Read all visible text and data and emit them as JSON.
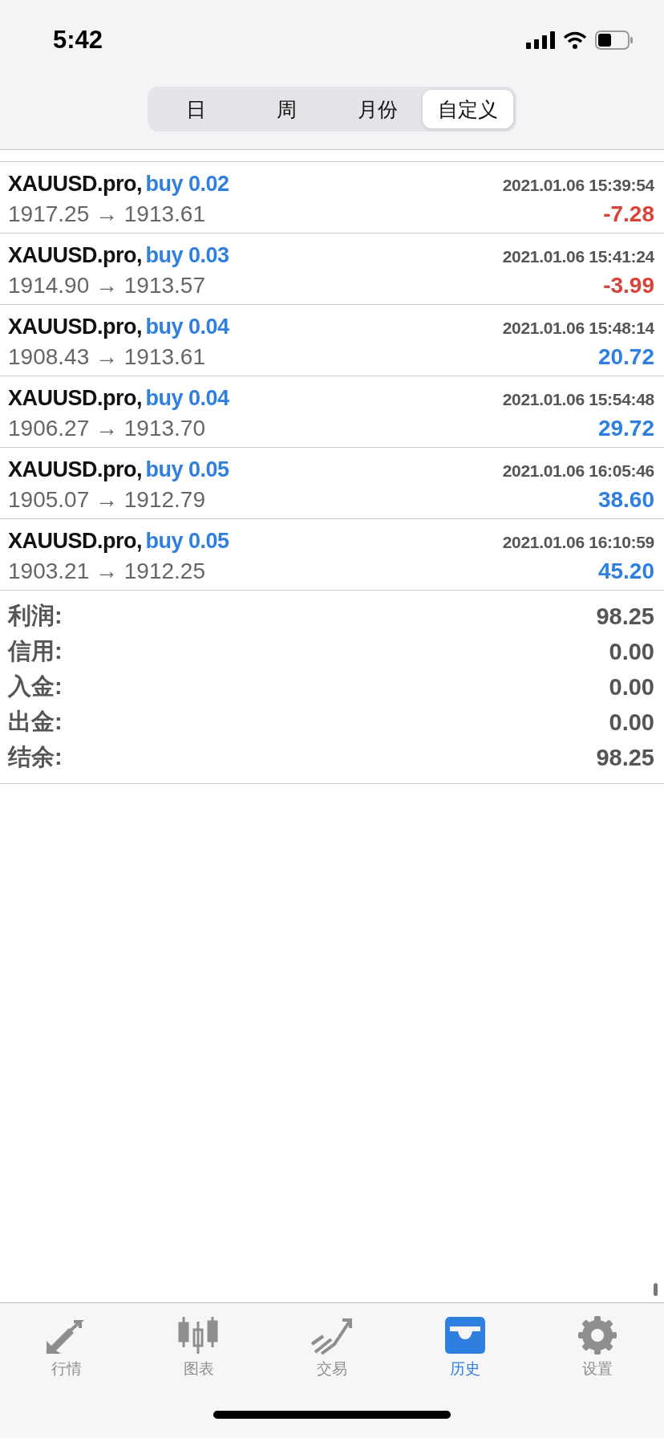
{
  "status_bar": {
    "time": "5:42"
  },
  "period_tabs": [
    {
      "label": "日",
      "selected": false
    },
    {
      "label": "周",
      "selected": false
    },
    {
      "label": "月份",
      "selected": false
    },
    {
      "label": "自定义",
      "selected": true
    }
  ],
  "deals": [
    {
      "symbol": "XAUUSD.pro,",
      "side": "buy 0.02",
      "time": "2021.01.06 15:39:54",
      "prices": "1917.25 → 1913.61",
      "profit": "-7.28",
      "color": "#d8433a"
    },
    {
      "symbol": "XAUUSD.pro,",
      "side": "buy 0.03",
      "time": "2021.01.06 15:41:24",
      "prices": "1914.90 → 1913.57",
      "profit": "-3.99",
      "color": "#d8433a"
    },
    {
      "symbol": "XAUUSD.pro,",
      "side": "buy 0.04",
      "time": "2021.01.06 15:48:14",
      "prices": "1908.43 → 1913.61",
      "profit": "20.72",
      "color": "#2f7fe0"
    },
    {
      "symbol": "XAUUSD.pro,",
      "side": "buy 0.04",
      "time": "2021.01.06 15:54:48",
      "prices": "1906.27 → 1913.70",
      "profit": "29.72",
      "color": "#2f7fe0"
    },
    {
      "symbol": "XAUUSD.pro,",
      "side": "buy 0.05",
      "time": "2021.01.06 16:05:46",
      "prices": "1905.07 → 1912.79",
      "profit": "38.60",
      "color": "#2f7fe0"
    },
    {
      "symbol": "XAUUSD.pro,",
      "side": "buy 0.05",
      "time": "2021.01.06 16:10:59",
      "prices": "1903.21 → 1912.25",
      "profit": "45.20",
      "color": "#2f7fe0"
    }
  ],
  "summary": [
    {
      "label": "利润:",
      "value": "98.25"
    },
    {
      "label": "信用:",
      "value": "0.00"
    },
    {
      "label": "入金:",
      "value": "0.00"
    },
    {
      "label": "出金:",
      "value": "0.00"
    },
    {
      "label": "结余:",
      "value": "98.25"
    }
  ],
  "bottom_tabs": [
    {
      "label": "行情",
      "kind": "quotes",
      "selected": false
    },
    {
      "label": "图表",
      "kind": "chart",
      "selected": false
    },
    {
      "label": "交易",
      "kind": "trade",
      "selected": false
    },
    {
      "label": "历史",
      "kind": "history",
      "selected": true
    },
    {
      "label": "设置",
      "kind": "settings",
      "selected": false
    }
  ]
}
